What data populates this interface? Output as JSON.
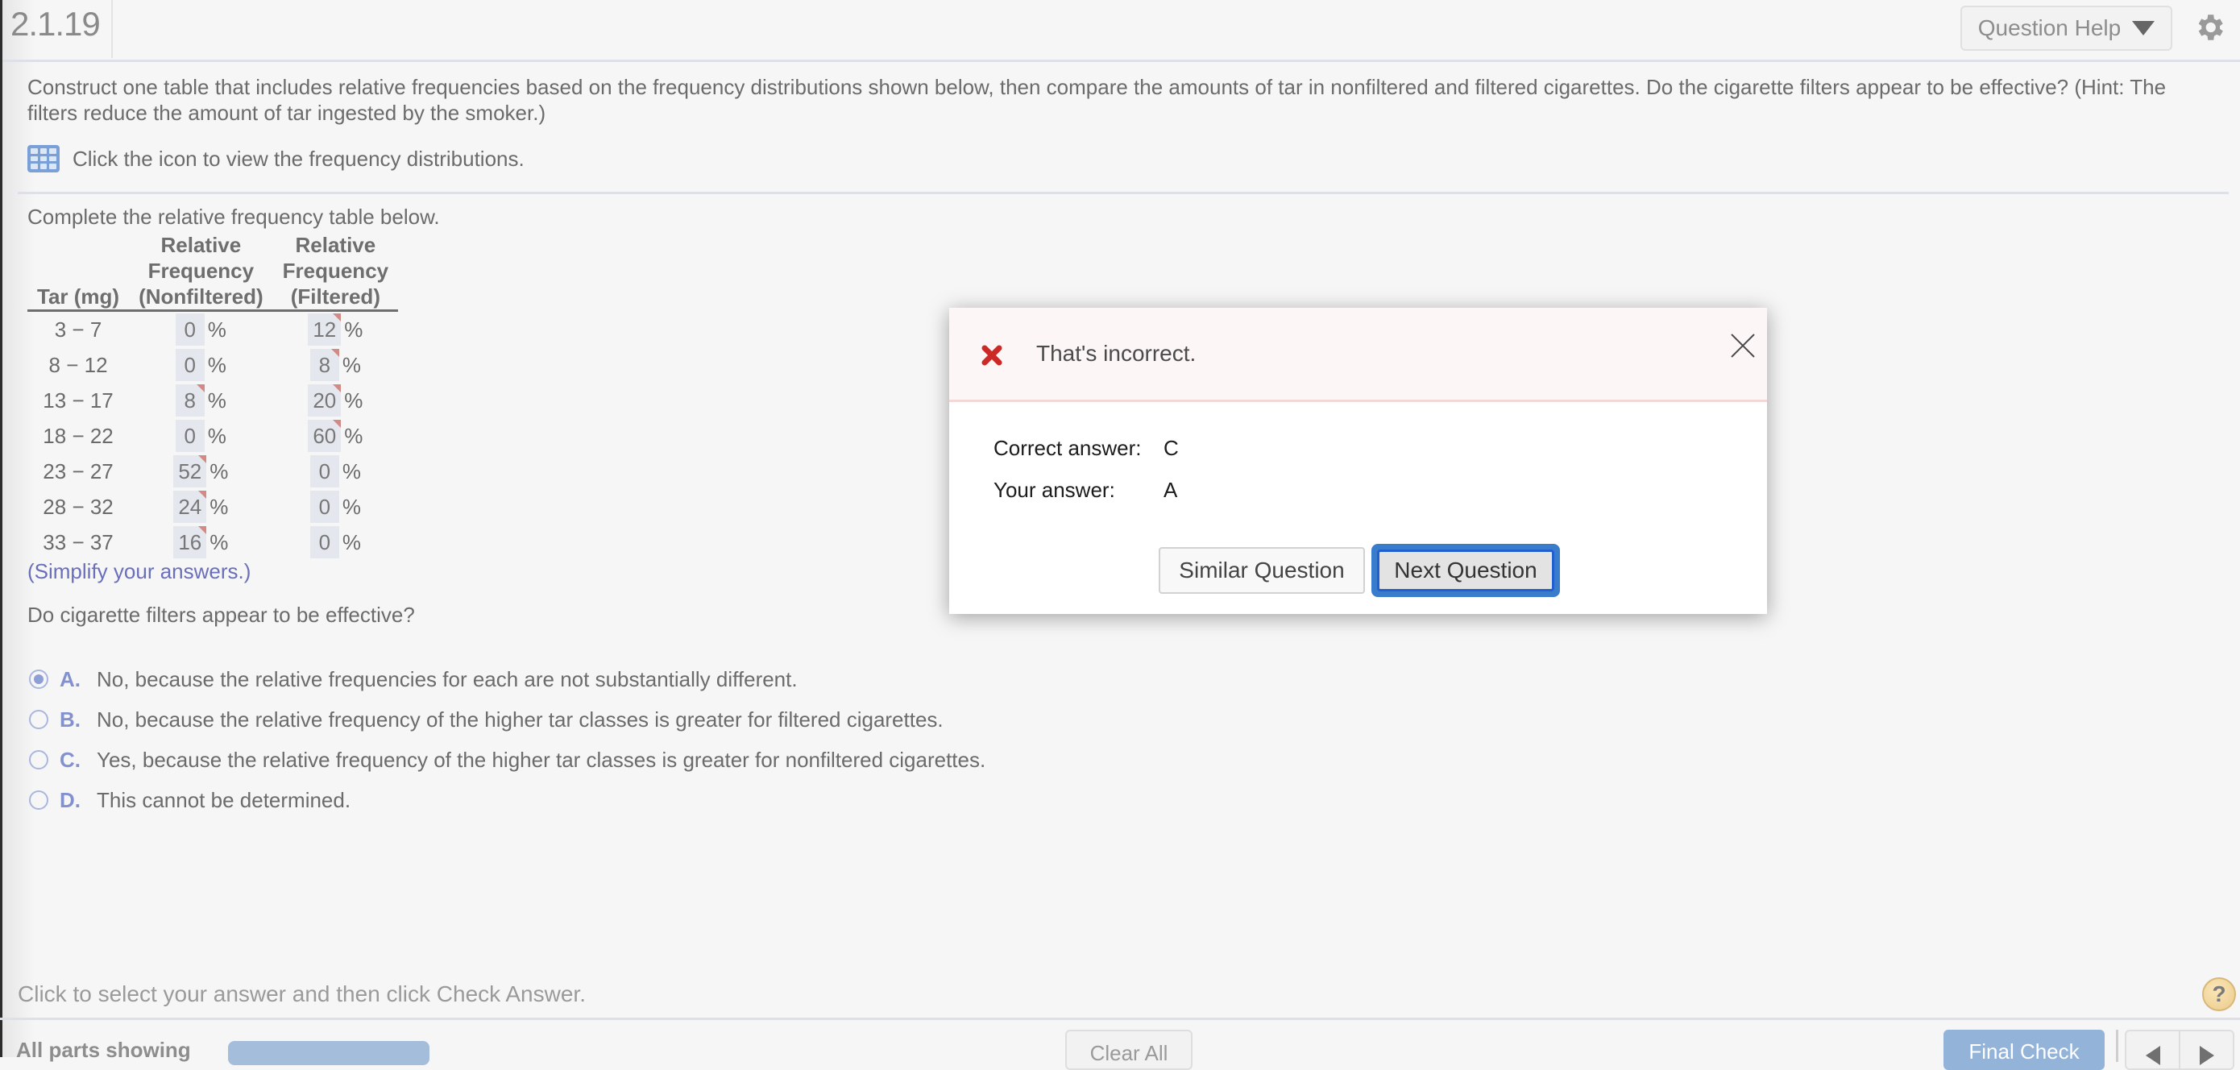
{
  "header": {
    "question_number": "2.1.19",
    "help_button_label": "Question Help"
  },
  "question": {
    "instructions": "Construct one table that includes relative frequencies based on the frequency distributions shown below, then compare the amounts of tar in nonfiltered and filtered cigarettes. Do the cigarette filters appear to be effective? (Hint: The filters reduce the amount of tar ingested by the smoker.)",
    "icon_hint": "Click the icon to view the frequency distributions.",
    "table_prompt": "Complete the relative frequency table below.",
    "table": {
      "headers": [
        {
          "lines": [
            "Tar (mg)"
          ]
        },
        {
          "lines": [
            "Relative",
            "Frequency",
            "(Nonfiltered)"
          ]
        },
        {
          "lines": [
            "Relative",
            "Frequency",
            "(Filtered)"
          ]
        }
      ],
      "unit": "%",
      "rows": [
        {
          "tar": "3 − 7",
          "nonfiltered": "0",
          "nonfiltered_flag": false,
          "filtered": "12",
          "filtered_flag": true
        },
        {
          "tar": "8 − 12",
          "nonfiltered": "0",
          "nonfiltered_flag": false,
          "filtered": "8",
          "filtered_flag": true
        },
        {
          "tar": "13 − 17",
          "nonfiltered": "8",
          "nonfiltered_flag": true,
          "filtered": "20",
          "filtered_flag": true
        },
        {
          "tar": "18 − 22",
          "nonfiltered": "0",
          "nonfiltered_flag": false,
          "filtered": "60",
          "filtered_flag": true
        },
        {
          "tar": "23 − 27",
          "nonfiltered": "52",
          "nonfiltered_flag": true,
          "filtered": "0",
          "filtered_flag": false
        },
        {
          "tar": "28 − 32",
          "nonfiltered": "24",
          "nonfiltered_flag": true,
          "filtered": "0",
          "filtered_flag": false
        },
        {
          "tar": "33 − 37",
          "nonfiltered": "16",
          "nonfiltered_flag": true,
          "filtered": "0",
          "filtered_flag": false
        }
      ]
    },
    "simplify_note": "(Simplify your answers.)",
    "mc_prompt": "Do cigarette filters appear to be effective?",
    "choices": [
      {
        "letter": "A.",
        "text": "No, because the relative frequencies for each are not substantially different.",
        "selected": true
      },
      {
        "letter": "B.",
        "text": "No, because the relative frequency of the higher tar classes is greater for filtered cigarettes.",
        "selected": false
      },
      {
        "letter": "C.",
        "text": "Yes, because the relative frequency of the higher tar classes is greater for nonfiltered cigarettes.",
        "selected": false
      },
      {
        "letter": "D.",
        "text": "This cannot be determined.",
        "selected": false
      }
    ]
  },
  "footer": {
    "hint": "Click to select your answer and then click Check Answer.",
    "help_icon": "?",
    "parts_label": "All parts showing",
    "clear_all_label": "Clear All",
    "final_check_label": "Final Check"
  },
  "dialog": {
    "status_icon": "x-mark-icon",
    "title": "That's incorrect.",
    "correct_label": "Correct answer:",
    "correct_value": "C",
    "your_label": "Your answer:",
    "your_value": "A",
    "similar_button": "Similar Question",
    "next_button": "Next Question",
    "colors": {
      "error": "#cc2a26",
      "focus": "#3a7ccc"
    }
  }
}
